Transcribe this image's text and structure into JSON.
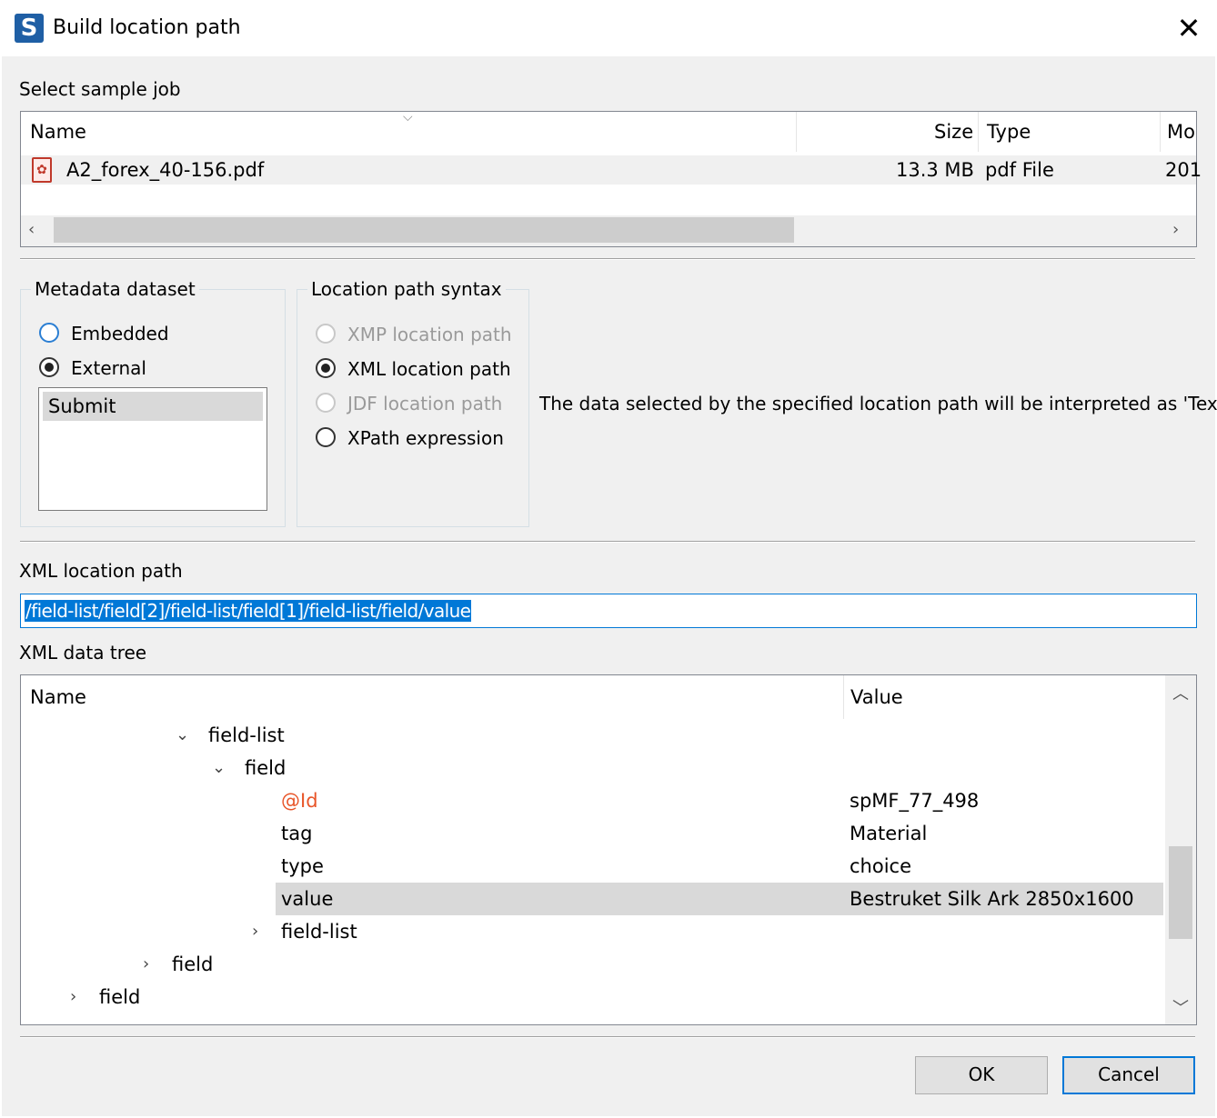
{
  "window": {
    "title": "Build location path",
    "app_icon_letter": "S"
  },
  "sample_job": {
    "label": "Select sample job",
    "columns": {
      "name": "Name",
      "size": "Size",
      "type": "Type",
      "modified": "Mo"
    },
    "rows": [
      {
        "name": "A2_forex_40-156.pdf",
        "size": "13.3 MB",
        "type": "pdf File",
        "modified": "201"
      }
    ]
  },
  "metadata_dataset": {
    "title": "Metadata dataset",
    "options": [
      "Embedded",
      "External"
    ],
    "selected": "External",
    "list_items": [
      "Submit"
    ]
  },
  "location_syntax": {
    "title": "Location path syntax",
    "options": [
      {
        "label": "XMP location path",
        "enabled": false,
        "selected": false
      },
      {
        "label": "XML location path",
        "enabled": true,
        "selected": true
      },
      {
        "label": "JDF location path",
        "enabled": false,
        "selected": false
      },
      {
        "label": "XPath expression",
        "enabled": true,
        "selected": false
      }
    ],
    "info": "The data selected by the specified location path will be interpreted as 'Text'"
  },
  "xml_path": {
    "label": "XML location path",
    "value": "/field-list/field[2]/field-list/field[1]/field-list/field/value"
  },
  "xml_tree": {
    "label": "XML data tree",
    "columns": {
      "name": "Name",
      "value": "Value"
    },
    "rows": [
      {
        "name": "field-list",
        "value": ""
      },
      {
        "name": "field",
        "value": ""
      },
      {
        "name": "@Id",
        "value": "spMF_77_498"
      },
      {
        "name": "tag",
        "value": "Material"
      },
      {
        "name": "type",
        "value": "choice"
      },
      {
        "name": "value",
        "value": "Bestruket Silk Ark 2850x1600"
      },
      {
        "name": "field-list",
        "value": ""
      },
      {
        "name": "field",
        "value": ""
      },
      {
        "name": "field",
        "value": ""
      }
    ]
  },
  "buttons": {
    "ok": "OK",
    "cancel": "Cancel"
  },
  "colors": {
    "attribute": "#e8562a",
    "selection": "#0078d7",
    "row_highlight": "#d9d9d9"
  }
}
